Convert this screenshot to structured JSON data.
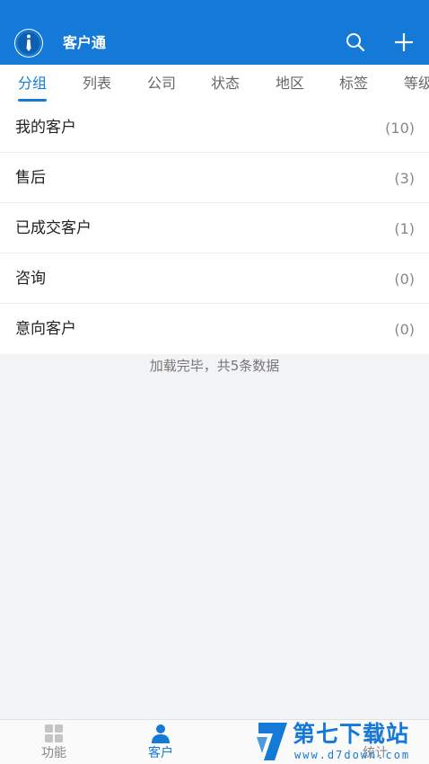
{
  "header": {
    "title": "客户通",
    "search_icon": "search-icon",
    "add_icon": "plus-icon",
    "color": "#1479d7"
  },
  "tabs": [
    {
      "label": "分组",
      "active": true
    },
    {
      "label": "列表"
    },
    {
      "label": "公司"
    },
    {
      "label": "状态"
    },
    {
      "label": "地区"
    },
    {
      "label": "标签"
    },
    {
      "label": "等级"
    }
  ],
  "groups": [
    {
      "name": "我的客户",
      "count": "(10)"
    },
    {
      "name": "售后",
      "count": "(3)"
    },
    {
      "name": "已成交客户",
      "count": "(1)"
    },
    {
      "name": "咨询",
      "count": "(0)"
    },
    {
      "name": "意向客户",
      "count": "(0)"
    }
  ],
  "status": {
    "load_message": "加载完毕，共5条数据"
  },
  "bottom_nav": [
    {
      "label": "功能",
      "icon": "grid-icon"
    },
    {
      "label": "客户",
      "icon": "person-icon",
      "active": true
    },
    {
      "label": "统计",
      "icon": "chart-icon"
    }
  ],
  "watermark": {
    "text": "第七下载站",
    "url": "www.d7down.com"
  }
}
